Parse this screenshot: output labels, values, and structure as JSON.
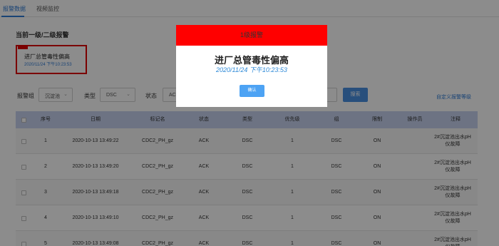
{
  "tabs": [
    {
      "label": "报警数据",
      "active": true
    },
    {
      "label": "视频监控",
      "active": false
    }
  ],
  "section_title": "当前一级/二级报警",
  "alarm_card": {
    "message": "进厂总管毒性偏高",
    "time": "2020/11/24 下午10:23:53"
  },
  "filters": {
    "group_label": "报警组",
    "group_value": "沉淀池",
    "type_label": "类型",
    "type_value": "DSC",
    "status_label": "状态",
    "status_value": "ACK",
    "search_label": "搜索",
    "custom_link": "自定义报警等级"
  },
  "table": {
    "columns": [
      "序号",
      "日期",
      "标记名",
      "状态",
      "类型",
      "优先级",
      "组",
      "限制",
      "操作员",
      "注释"
    ],
    "rows": [
      {
        "index": "1",
        "date": "2020-10-13 13:49:22",
        "tag": "CDC2_PH_gz",
        "status": "ACK",
        "type": "DSC",
        "priority": "1",
        "group": "DSC",
        "limit": "ON",
        "operator": "",
        "note": "2#沉淀池出水pH仪故障"
      },
      {
        "index": "2",
        "date": "2020-10-13 13:49:20",
        "tag": "CDC2_PH_gz",
        "status": "ACK",
        "type": "DSC",
        "priority": "1",
        "group": "DSC",
        "limit": "ON",
        "operator": "",
        "note": "2#沉淀池出水pH仪故障"
      },
      {
        "index": "3",
        "date": "2020-10-13 13:49:18",
        "tag": "CDC2_PH_gz",
        "status": "ACK",
        "type": "DSC",
        "priority": "1",
        "group": "DSC",
        "limit": "ON",
        "operator": "",
        "note": "2#沉淀池出水pH仪故障"
      },
      {
        "index": "4",
        "date": "2020-10-13 13:49:10",
        "tag": "CDC2_PH_gz",
        "status": "ACK",
        "type": "DSC",
        "priority": "1",
        "group": "DSC",
        "limit": "ON",
        "operator": "",
        "note": "2#沉淀池出水pH仪故障"
      },
      {
        "index": "5",
        "date": "2020-10-13 13:49:08",
        "tag": "CDC2_PH_gz",
        "status": "ACK",
        "type": "DSC",
        "priority": "1",
        "group": "DSC",
        "limit": "ON",
        "operator": "",
        "note": "2#沉淀池出水pH仪故障"
      }
    ]
  },
  "modal": {
    "header": "1级报警",
    "title": "进厂总管毒性偏高",
    "time": "2020/11/24 下午10:23:53",
    "confirm_label": "确认"
  },
  "colors": {
    "accent": "#2f7bd6",
    "alarm_red": "#ff0000",
    "table_header": "#c7d2ee"
  }
}
